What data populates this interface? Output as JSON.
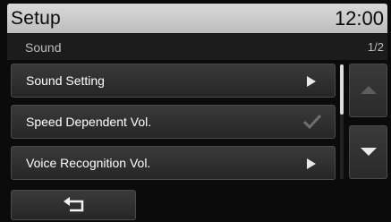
{
  "header": {
    "title": "Setup",
    "clock": "12:00"
  },
  "subheader": {
    "section": "Sound",
    "page": "1/2"
  },
  "menu": {
    "items": [
      {
        "label": "Sound Setting",
        "control": "arrow"
      },
      {
        "label": "Speed Dependent Vol.",
        "control": "checkbox",
        "checked": true
      },
      {
        "label": "Voice Recognition Vol.",
        "control": "arrow"
      }
    ]
  },
  "scroll": {
    "up_icon": "triangle-up-icon",
    "down_icon": "triangle-down-icon",
    "up_enabled": false,
    "down_enabled": true
  },
  "footer": {
    "back_icon": "return-arrow-icon"
  },
  "colors": {
    "header_bg": "#cfcfcf",
    "item_bg": "#2e2e2e",
    "background": "#0b0b0b"
  }
}
